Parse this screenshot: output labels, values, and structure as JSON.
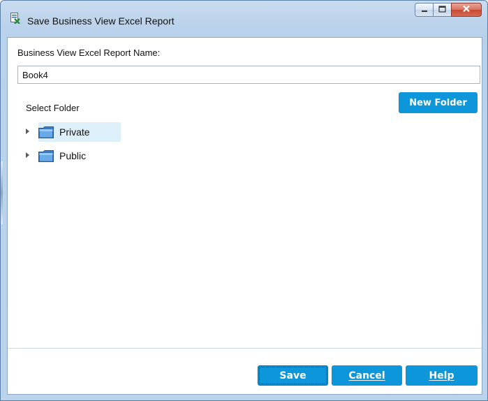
{
  "window": {
    "title": "Save Business View Excel Report",
    "icons": {
      "app": "report-icon",
      "minimize": "minimize-icon",
      "maximize": "maximize-icon",
      "close": "close-icon"
    },
    "colors": {
      "accent": "#0d96da",
      "selection": "#ddeff9",
      "close_button": "#c74a35"
    }
  },
  "form": {
    "name_label": "Business View Excel Report Name:",
    "name_value": "Book4",
    "select_folder_label": "Select Folder",
    "new_folder_label": "New Folder"
  },
  "tree": {
    "items": [
      {
        "label": "Private",
        "icon": "folder-icon",
        "expander": "collapsed-arrow-icon",
        "selected": true
      },
      {
        "label": "Public",
        "icon": "folder-icon",
        "expander": "collapsed-arrow-icon",
        "selected": false
      }
    ]
  },
  "footer": {
    "save_label": "Save",
    "cancel_label": "Cancel",
    "help_label": "Help"
  }
}
